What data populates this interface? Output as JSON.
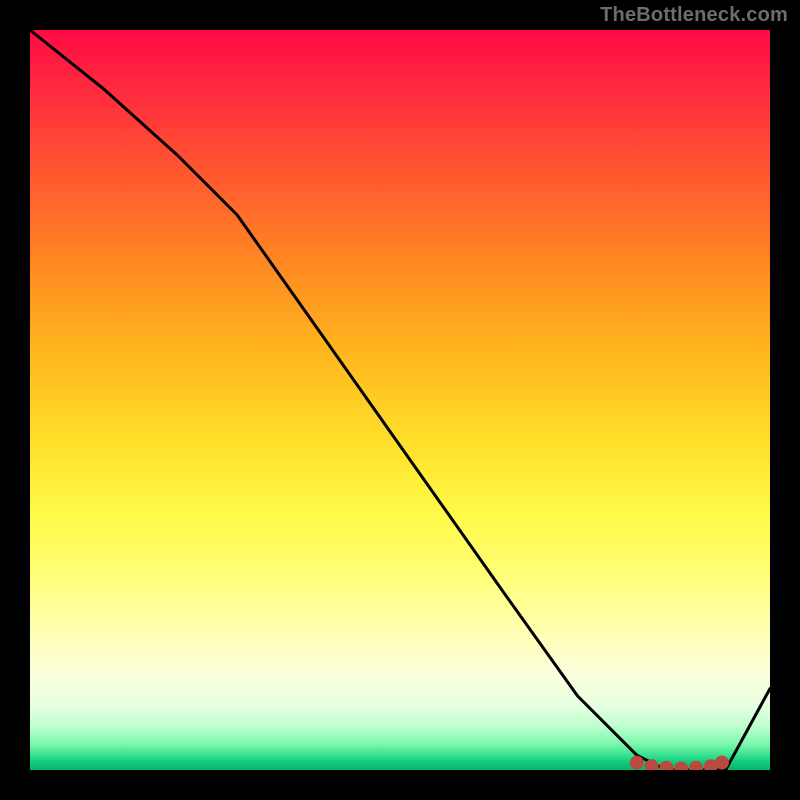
{
  "watermark": "TheBottleneck.com",
  "chart_data": {
    "type": "line",
    "title": "",
    "xlabel": "",
    "ylabel": "",
    "xlim": [
      0,
      100
    ],
    "ylim": [
      0,
      100
    ],
    "x": [
      0,
      10,
      20,
      28,
      40,
      52,
      64,
      74,
      82,
      86,
      90,
      94,
      100
    ],
    "values": [
      100,
      92,
      83,
      75,
      58,
      41,
      24,
      10,
      2,
      0,
      0,
      0,
      11
    ],
    "markers_x": [
      82,
      84,
      86,
      88,
      90,
      92,
      93.5
    ],
    "markers_y": [
      1,
      0.5,
      0.3,
      0.2,
      0.3,
      0.5,
      1
    ],
    "gradient_note": "background heat gradient red→yellow→green"
  }
}
